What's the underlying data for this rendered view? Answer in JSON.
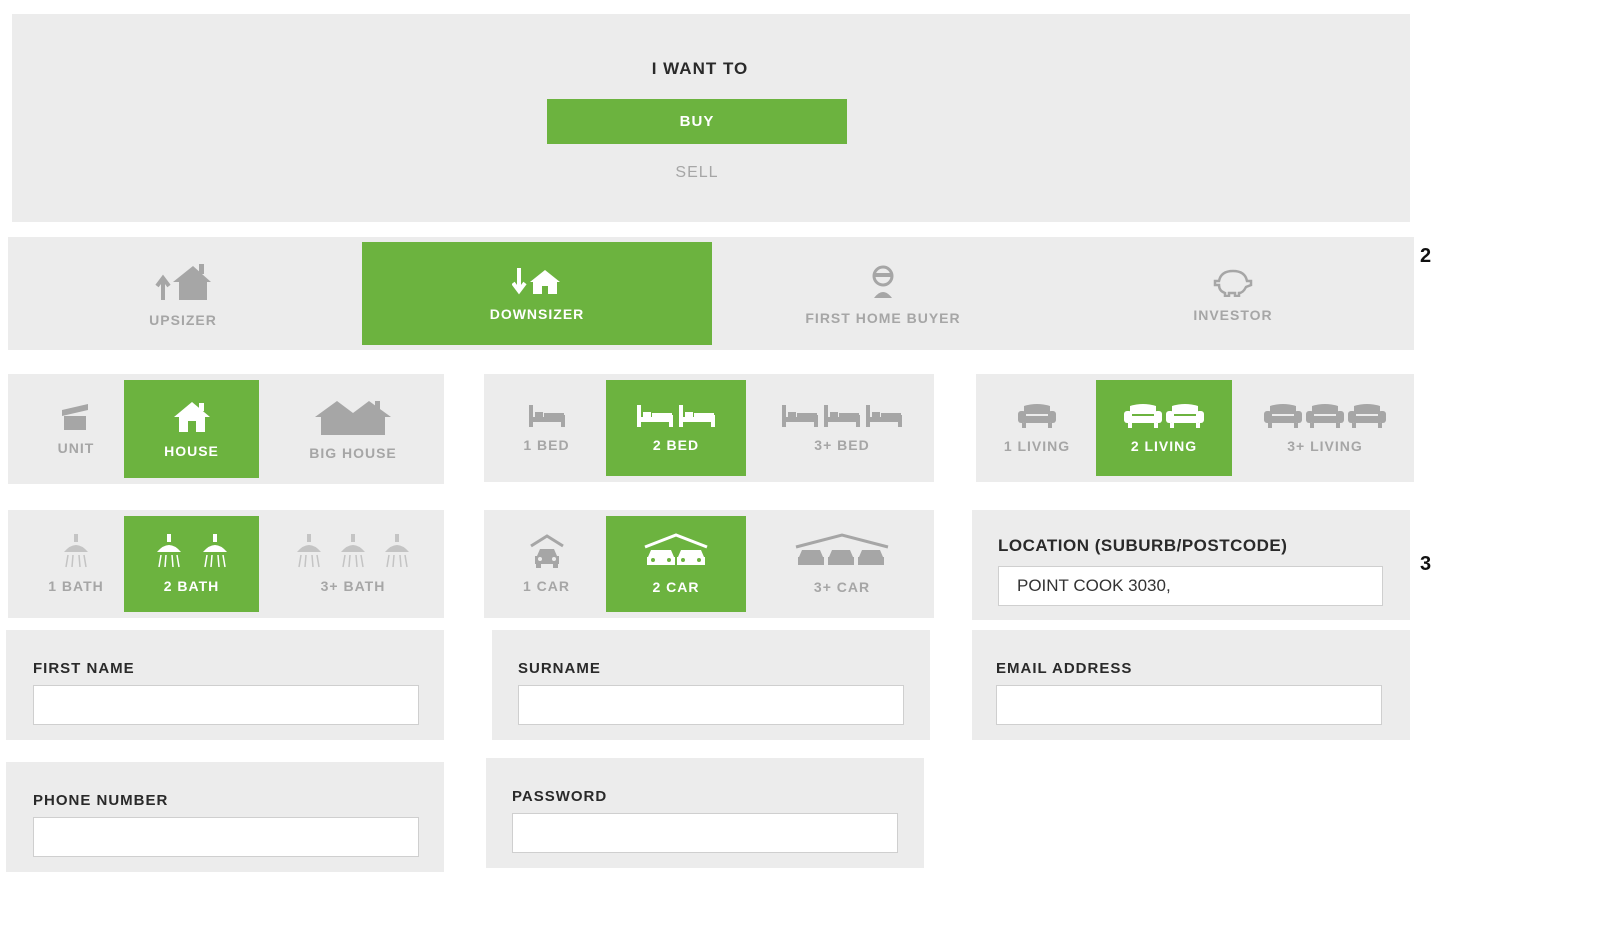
{
  "intent": {
    "title": "I WANT TO",
    "buy_label": "BUY",
    "sell_label": "SELL"
  },
  "profiles": [
    {
      "label": "UPSIZER",
      "icon": "upsize-house-icon",
      "selected": false
    },
    {
      "label": "DOWNSIZER",
      "icon": "downsize-house-icon",
      "selected": true
    },
    {
      "label": "FIRST HOME BUYER",
      "icon": "person-icon",
      "selected": false
    },
    {
      "label": "INVESTOR",
      "icon": "piggy-bank-icon",
      "selected": false
    }
  ],
  "property_type": [
    {
      "label": "UNIT",
      "icon": "unit-icon",
      "selected": false
    },
    {
      "label": "HOUSE",
      "icon": "house-icon",
      "selected": true
    },
    {
      "label": "BIG HOUSE",
      "icon": "big-house-icon",
      "selected": false
    }
  ],
  "bedrooms": [
    {
      "label": "1 BED",
      "icon": "bed-icon",
      "selected": false
    },
    {
      "label": "2 BED",
      "icon": "bed-icon",
      "selected": true
    },
    {
      "label": "3+ BED",
      "icon": "bed-icon",
      "selected": false
    }
  ],
  "living": [
    {
      "label": "1 LIVING",
      "icon": "armchair-icon",
      "selected": false
    },
    {
      "label": "2 LIVING",
      "icon": "armchair-icon",
      "selected": true
    },
    {
      "label": "3+ LIVING",
      "icon": "armchair-icon",
      "selected": false
    }
  ],
  "bathrooms": [
    {
      "label": "1 BATH",
      "icon": "shower-icon",
      "selected": false
    },
    {
      "label": "2 BATH",
      "icon": "shower-icon",
      "selected": true
    },
    {
      "label": "3+ BATH",
      "icon": "shower-icon",
      "selected": false
    }
  ],
  "cars": [
    {
      "label": "1 CAR",
      "icon": "car-garage-icon",
      "selected": false
    },
    {
      "label": "2 CAR",
      "icon": "car-garage-icon",
      "selected": true
    },
    {
      "label": "3+ CAR",
      "icon": "car-garage-icon",
      "selected": false
    }
  ],
  "location": {
    "label": "LOCATION (SUBURB/POSTCODE)",
    "value": "POINT COOK 3030,"
  },
  "form": {
    "first_name_label": "FIRST NAME",
    "surname_label": "SURNAME",
    "email_label": "EMAIL ADDRESS",
    "phone_label": "PHONE NUMBER",
    "password_label": "PASSWORD"
  },
  "annotations": {
    "marker_2": "2",
    "marker_3": "3"
  },
  "colors": {
    "accent": "#6cb33f",
    "panel": "#ececec",
    "muted": "#a6a6a6"
  }
}
